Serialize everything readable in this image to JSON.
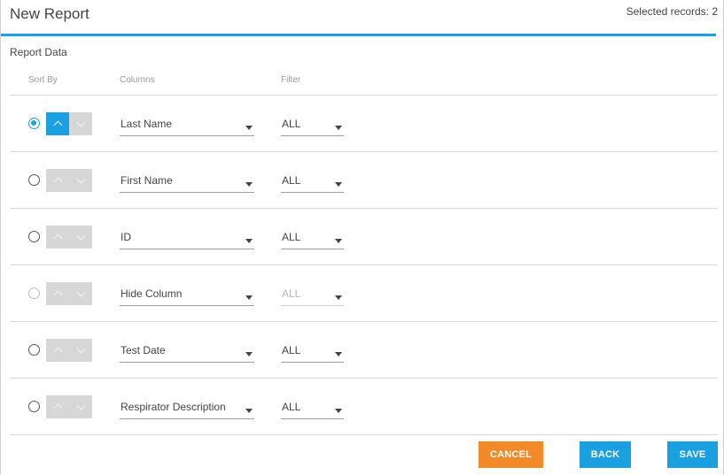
{
  "header": {
    "title": "New Report",
    "selected_records": "Selected records: 2"
  },
  "section": {
    "label": "Report Data"
  },
  "columns_head": {
    "sort": "Sort By",
    "columns": "Columns",
    "filter": "Filter"
  },
  "rows": [
    {
      "column": "Last Name",
      "filter": "ALL"
    },
    {
      "column": "First Name",
      "filter": "ALL"
    },
    {
      "column": "ID",
      "filter": "ALL"
    },
    {
      "column": "Hide Column",
      "filter": "ALL"
    },
    {
      "column": "Test Date",
      "filter": "ALL"
    },
    {
      "column": "Respirator Description",
      "filter": "ALL"
    }
  ],
  "buttons": {
    "cancel": "CANCEL",
    "back": "BACK",
    "save": "SAVE"
  },
  "colors": {
    "accent": "#1a9fe0",
    "cancel": "#f28a2a",
    "sort_inactive": "#d7d7d7"
  }
}
